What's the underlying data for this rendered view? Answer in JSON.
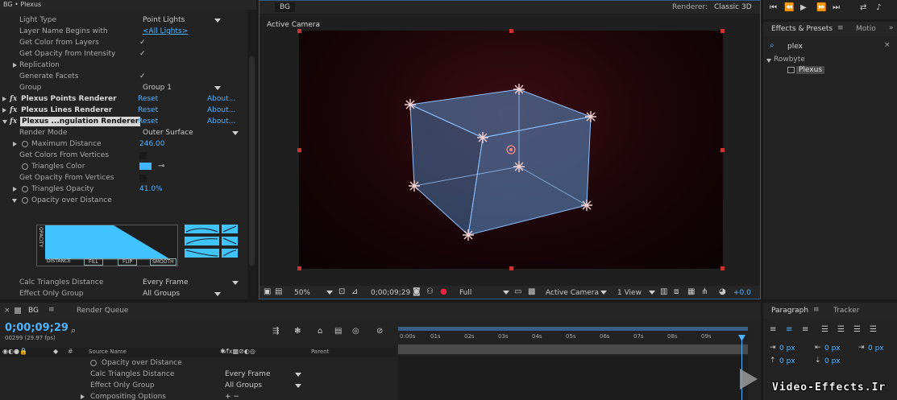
{
  "effect_controls": {
    "title": "BG • Plexus",
    "rows": [
      {
        "label": "Light Type",
        "value": "Point Lights"
      },
      {
        "label": "Layer Name Begins with",
        "value": "<All Lights>"
      },
      {
        "label": "Get Color from Layers",
        "value": "✓"
      },
      {
        "label": "Get Opacity from Intensity",
        "value": "✓"
      },
      {
        "label": "Replication",
        "value": ""
      },
      {
        "label": "Generate Facets",
        "value": "✓"
      },
      {
        "label": "Group",
        "value": "Group 1"
      }
    ],
    "effects": [
      {
        "name": "Plexus Points Renderer",
        "reset": "Reset",
        "about": "About..."
      },
      {
        "name": "Plexus Lines Renderer",
        "reset": "Reset",
        "about": "About..."
      },
      {
        "name": "Plexus ...ngulation Renderer",
        "reset": "Reset",
        "about": "About..."
      }
    ],
    "tri_rows": [
      {
        "label": "Render Mode",
        "value": "Outer Surface"
      },
      {
        "label": "Maximum Distance",
        "value": "246.00"
      },
      {
        "label": "Get Colors From Vertices",
        "value": ""
      },
      {
        "label": "Triangles Color",
        "value": ""
      },
      {
        "label": "Get Opacity From Vertices",
        "value": ""
      },
      {
        "label": "Triangles Opacity",
        "value": "41.0%"
      },
      {
        "label": "Opacity over Distance",
        "value": ""
      }
    ],
    "graph": {
      "ylabel": "OPACITY",
      "btn_distance": "DISTANCE",
      "btn_fill": "FILL",
      "btn_flip": "FLIP",
      "btn_smooth": "SMOOTH"
    },
    "bottom_rows": [
      {
        "label": "Calc Triangles Distance",
        "value": "Every Frame"
      },
      {
        "label": "Effect Only Group",
        "value": "All Groups"
      }
    ],
    "swatch_color": "#3fb8ff"
  },
  "composition": {
    "tab": "BG",
    "renderer_label": "Renderer:",
    "renderer_value": "Classic 3D",
    "camera_label": "Active Camera",
    "zoom": "50%",
    "timecode": "0;00;09;29",
    "resolution": "Full",
    "view": "Active Camera",
    "views": "1 View",
    "exposure": "+0.0"
  },
  "effects_presets": {
    "tab1": "Effects & Presets",
    "tab2": "Motio",
    "search": "plex",
    "category": "Rowbyte",
    "item": "Plexus"
  },
  "paragraph": {
    "tab1": "Paragraph",
    "tab2": "Tracker",
    "px1": "0 px",
    "px2": "0 px",
    "px3": "0 px",
    "px4": "0 px",
    "px5": "0 px"
  },
  "timeline": {
    "tab1": "BG",
    "tab2": "Render Queue",
    "timecode": "0;00;09;29",
    "frames": "00299 (29.97 fps)",
    "col_source": "Source Name",
    "col_parent": "Parent",
    "ruler": [
      "0:00s",
      "01s",
      "02s",
      "03s",
      "04s",
      "05s",
      "06s",
      "07s",
      "08s",
      "09s"
    ],
    "rows": [
      {
        "label": "Opacity over Distance",
        "value": ""
      },
      {
        "label": "Calc Triangles Distance",
        "value": "Every Frame"
      },
      {
        "label": "Effect Only Group",
        "value": "All Groups"
      },
      {
        "label": "Compositing Options",
        "value": "+ −"
      }
    ]
  },
  "watermark": "Video-Effects.Ir"
}
